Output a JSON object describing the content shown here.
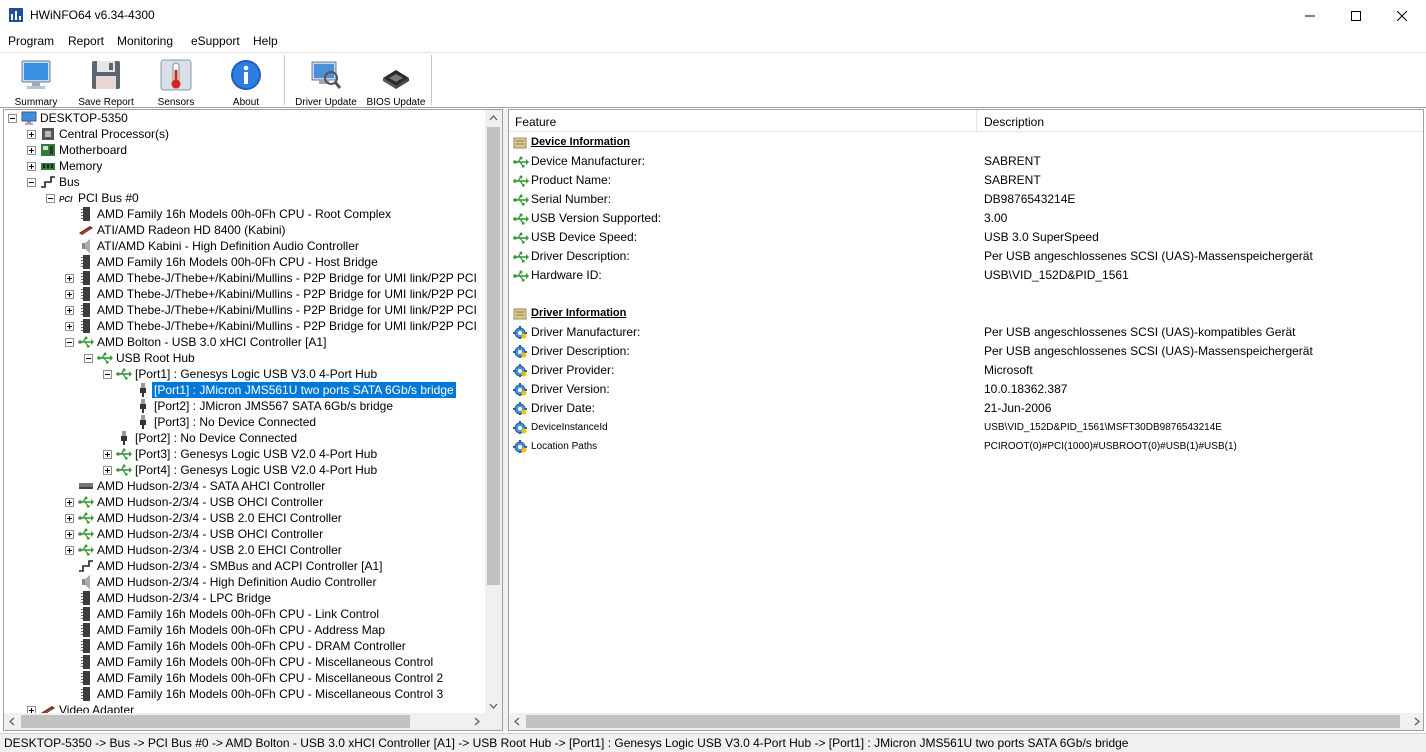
{
  "window": {
    "title": "HWiNFO64 v6.34-4300"
  },
  "menu": [
    "Program",
    "Report",
    "Monitoring",
    "eSupport",
    "Help"
  ],
  "toolbar": {
    "buttons": [
      {
        "label": "Summary",
        "icon": "monitor-icon"
      },
      {
        "label": "Save Report",
        "icon": "floppy-icon"
      },
      {
        "label": "Sensors",
        "icon": "thermometer-icon"
      },
      {
        "label": "About",
        "icon": "info-icon"
      },
      {
        "label": "Driver Update",
        "icon": "driver-update-icon"
      },
      {
        "label": "BIOS Update",
        "icon": "chip-icon"
      }
    ]
  },
  "tree": [
    {
      "level": 0,
      "expander": "minus",
      "icon": "computer",
      "label": "DESKTOP-5350"
    },
    {
      "level": 1,
      "expander": "plus",
      "icon": "cpu",
      "label": "Central Processor(s)"
    },
    {
      "level": 1,
      "expander": "plus",
      "icon": "board",
      "label": "Motherboard"
    },
    {
      "level": 1,
      "expander": "plus",
      "icon": "memory",
      "label": "Memory"
    },
    {
      "level": 1,
      "expander": "minus",
      "icon": "bus",
      "label": "Bus"
    },
    {
      "level": 2,
      "expander": "minus",
      "icon": "pci",
      "label": "PCI Bus #0"
    },
    {
      "level": 3,
      "expander": "",
      "icon": "device",
      "label": "AMD Family 16h Models 00h-0Fh CPU - Root Complex"
    },
    {
      "level": 3,
      "expander": "",
      "icon": "gpu",
      "label": "ATI/AMD Radeon HD 8400 (Kabini)"
    },
    {
      "level": 3,
      "expander": "",
      "icon": "audio",
      "label": "ATI/AMD Kabini - High Definition Audio Controller"
    },
    {
      "level": 3,
      "expander": "",
      "icon": "device",
      "label": "AMD Family 16h Models 00h-0Fh CPU - Host Bridge"
    },
    {
      "level": 3,
      "expander": "plus",
      "icon": "device",
      "label": "AMD Thebe-J/Thebe+/Kabini/Mullins - P2P Bridge for UMI link/P2P PCI"
    },
    {
      "level": 3,
      "expander": "plus",
      "icon": "device",
      "label": "AMD Thebe-J/Thebe+/Kabini/Mullins - P2P Bridge for UMI link/P2P PCI"
    },
    {
      "level": 3,
      "expander": "plus",
      "icon": "device",
      "label": "AMD Thebe-J/Thebe+/Kabini/Mullins - P2P Bridge for UMI link/P2P PCI"
    },
    {
      "level": 3,
      "expander": "plus",
      "icon": "device",
      "label": "AMD Thebe-J/Thebe+/Kabini/Mullins - P2P Bridge for UMI link/P2P PCI"
    },
    {
      "level": 3,
      "expander": "minus",
      "icon": "usb",
      "label": "AMD Bolton - USB 3.0 xHCI Controller [A1]"
    },
    {
      "level": 4,
      "expander": "minus",
      "icon": "usb",
      "label": "USB Root Hub"
    },
    {
      "level": 5,
      "expander": "minus",
      "icon": "usb",
      "label": "[Port1] : Genesys Logic USB V3.0 4-Port Hub"
    },
    {
      "level": 6,
      "expander": "",
      "icon": "plug",
      "label": "[Port1] : JMicron JMS561U two ports SATA 6Gb/s bridge",
      "selected": true
    },
    {
      "level": 6,
      "expander": "",
      "icon": "plug",
      "label": "[Port2] : JMicron JMS567 SATA 6Gb/s bridge"
    },
    {
      "level": 6,
      "expander": "",
      "icon": "plug",
      "label": "[Port3] : No Device Connected"
    },
    {
      "level": 5,
      "expander": "",
      "icon": "plug",
      "label": "[Port2] : No Device Connected"
    },
    {
      "level": 5,
      "expander": "plus",
      "icon": "usb",
      "label": "[Port3] : Genesys Logic USB V2.0 4-Port Hub"
    },
    {
      "level": 5,
      "expander": "plus",
      "icon": "usb",
      "label": "[Port4] : Genesys Logic USB V2.0 4-Port Hub"
    },
    {
      "level": 3,
      "expander": "",
      "icon": "disk",
      "label": "AMD Hudson-2/3/4 - SATA AHCI Controller"
    },
    {
      "level": 3,
      "expander": "plus",
      "icon": "usb",
      "label": "AMD Hudson-2/3/4 - USB OHCI Controller"
    },
    {
      "level": 3,
      "expander": "plus",
      "icon": "usb",
      "label": "AMD Hudson-2/3/4 - USB 2.0 EHCI Controller"
    },
    {
      "level": 3,
      "expander": "plus",
      "icon": "usb",
      "label": "AMD Hudson-2/3/4 - USB OHCI Controller"
    },
    {
      "level": 3,
      "expander": "plus",
      "icon": "usb",
      "label": "AMD Hudson-2/3/4 - USB 2.0 EHCI Controller"
    },
    {
      "level": 3,
      "expander": "",
      "icon": "bus",
      "label": "AMD Hudson-2/3/4 - SMBus and ACPI Controller [A1]"
    },
    {
      "level": 3,
      "expander": "",
      "icon": "audio",
      "label": "AMD Hudson-2/3/4 - High Definition Audio Controller"
    },
    {
      "level": 3,
      "expander": "",
      "icon": "device",
      "label": "AMD Hudson-2/3/4 - LPC Bridge"
    },
    {
      "level": 3,
      "expander": "",
      "icon": "device",
      "label": "AMD Family 16h Models 00h-0Fh CPU - Link Control"
    },
    {
      "level": 3,
      "expander": "",
      "icon": "device",
      "label": "AMD Family 16h Models 00h-0Fh CPU - Address Map"
    },
    {
      "level": 3,
      "expander": "",
      "icon": "device",
      "label": "AMD Family 16h Models 00h-0Fh CPU - DRAM Controller"
    },
    {
      "level": 3,
      "expander": "",
      "icon": "device",
      "label": "AMD Family 16h Models 00h-0Fh CPU - Miscellaneous Control"
    },
    {
      "level": 3,
      "expander": "",
      "icon": "device",
      "label": "AMD Family 16h Models 00h-0Fh CPU - Miscellaneous Control 2"
    },
    {
      "level": 3,
      "expander": "",
      "icon": "device",
      "label": "AMD Family 16h Models 00h-0Fh CPU - Miscellaneous Control 3"
    },
    {
      "level": 1,
      "expander": "plus",
      "icon": "gpu",
      "label": "Video Adapter"
    }
  ],
  "details": {
    "columns": {
      "feature": "Feature",
      "description": "Description"
    },
    "rows": [
      {
        "type": "section",
        "icon": "section",
        "feature": "Device Information",
        "value": ""
      },
      {
        "type": "item",
        "icon": "usb",
        "feature": "Device Manufacturer:",
        "value": "SABRENT"
      },
      {
        "type": "item",
        "icon": "usb",
        "feature": "Product Name:",
        "value": "SABRENT"
      },
      {
        "type": "item",
        "icon": "usb",
        "feature": "Serial Number:",
        "value": "DB9876543214E"
      },
      {
        "type": "item",
        "icon": "usb",
        "feature": "USB Version Supported:",
        "value": "3.00"
      },
      {
        "type": "item",
        "icon": "usb",
        "feature": "USB Device Speed:",
        "value": "USB 3.0 SuperSpeed"
      },
      {
        "type": "item",
        "icon": "usb",
        "feature": "Driver Description:",
        "value": "Per USB angeschlossenes SCSI (UAS)-Massenspeichergerät"
      },
      {
        "type": "item",
        "icon": "usb",
        "feature": "Hardware ID:",
        "value": "USB\\VID_152D&PID_1561"
      },
      {
        "type": "blank",
        "icon": "",
        "feature": "",
        "value": ""
      },
      {
        "type": "section",
        "icon": "section",
        "feature": "Driver Information",
        "value": ""
      },
      {
        "type": "item",
        "icon": "gear",
        "feature": "Driver Manufacturer:",
        "value": "Per USB angeschlossenes SCSI (UAS)-kompatibles Gerät"
      },
      {
        "type": "item",
        "icon": "gear",
        "feature": "Driver Description:",
        "value": "Per USB angeschlossenes SCSI (UAS)-Massenspeichergerät"
      },
      {
        "type": "item",
        "icon": "gear",
        "feature": "Driver Provider:",
        "value": "Microsoft"
      },
      {
        "type": "item",
        "icon": "gear",
        "feature": "Driver Version:",
        "value": "10.0.18362.387"
      },
      {
        "type": "item",
        "icon": "gear",
        "feature": "Driver Date:",
        "value": "21-Jun-2006"
      },
      {
        "type": "small",
        "icon": "gear",
        "feature": "DeviceInstanceId",
        "value": "USB\\VID_152D&PID_1561\\MSFT30DB9876543214E"
      },
      {
        "type": "small",
        "icon": "gear",
        "feature": "Location Paths",
        "value": "PCIROOT(0)#PCI(1000)#USBROOT(0)#USB(1)#USB(1)"
      }
    ]
  },
  "status": {
    "path": "DESKTOP-5350 -> Bus -> PCI Bus #0 -> AMD Bolton - USB 3.0 xHCI Controller [A1] -> USB Root Hub -> [Port1] : Genesys Logic USB V3.0 4-Port Hub -> [Port1] : JMicron JMS561U two ports SATA 6Gb/s bridge"
  },
  "colors": {
    "selection": "#0078d7",
    "usb_green": "#3a9a3a"
  }
}
